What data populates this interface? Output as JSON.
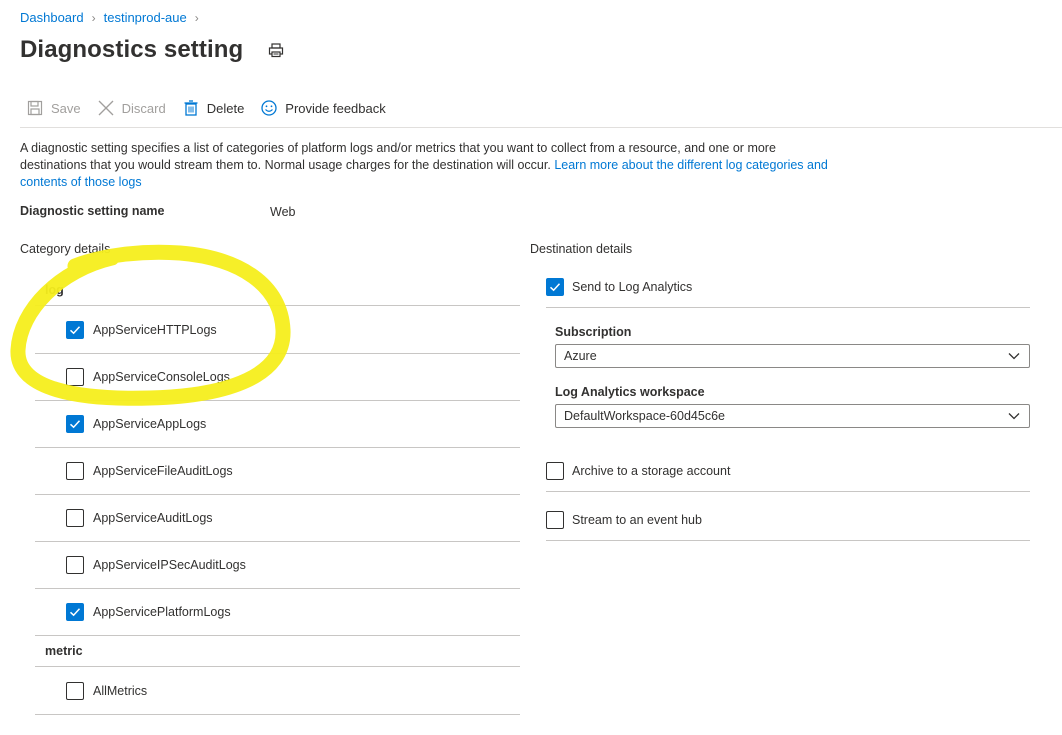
{
  "breadcrumb": {
    "items": [
      "Dashboard",
      "testinprod-aue"
    ]
  },
  "page": {
    "title": "Diagnostics setting"
  },
  "toolbar": {
    "save_label": "Save",
    "discard_label": "Discard",
    "delete_label": "Delete",
    "feedback_label": "Provide feedback"
  },
  "description": {
    "text": "A diagnostic setting specifies a list of categories of platform logs and/or metrics that you want to collect from a resource, and one or more destinations that you would stream them to. Normal usage charges for the destination will occur. ",
    "link": "Learn more about the different log categories and contents of those logs"
  },
  "setting_name": {
    "label": "Diagnostic setting name",
    "value": "Web"
  },
  "category_details": {
    "label": "Category details",
    "log_header": "log",
    "logs": [
      {
        "label": "AppServiceHTTPLogs",
        "checked": true
      },
      {
        "label": "AppServiceConsoleLogs",
        "checked": false
      },
      {
        "label": "AppServiceAppLogs",
        "checked": true
      },
      {
        "label": "AppServiceFileAuditLogs",
        "checked": false
      },
      {
        "label": "AppServiceAuditLogs",
        "checked": false
      },
      {
        "label": "AppServiceIPSecAuditLogs",
        "checked": false
      },
      {
        "label": "AppServicePlatformLogs",
        "checked": true
      }
    ],
    "metric_header": "metric",
    "metrics": [
      {
        "label": "AllMetrics",
        "checked": false
      }
    ]
  },
  "destination_details": {
    "label": "Destination details",
    "log_analytics": {
      "label": "Send to Log Analytics",
      "checked": true
    },
    "subscription": {
      "label": "Subscription",
      "value": "Azure"
    },
    "workspace": {
      "label": "Log Analytics workspace",
      "value": "DefaultWorkspace-60d45c6e"
    },
    "storage": {
      "label": "Archive to a storage account",
      "checked": false
    },
    "event_hub": {
      "label": "Stream to an event hub",
      "checked": false
    }
  },
  "colors": {
    "accent": "#0078d4",
    "highlight": "#f5ee1c"
  }
}
